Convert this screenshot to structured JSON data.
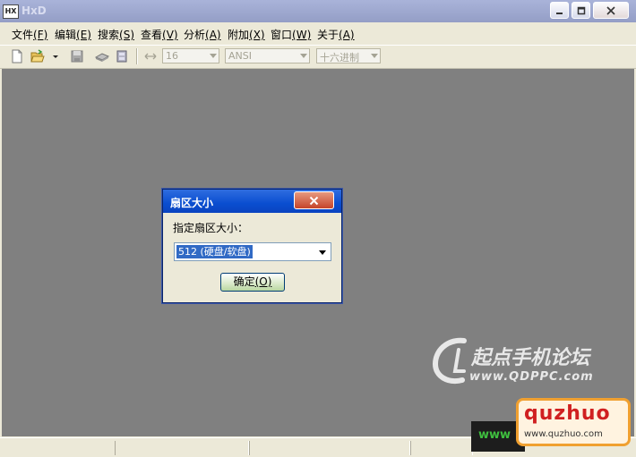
{
  "window": {
    "title": "HxD"
  },
  "caption_buttons": {
    "minimize": "minimize",
    "maximize": "maximize",
    "close": "close"
  },
  "menu": {
    "items": [
      {
        "label": "文件",
        "key": "(F)"
      },
      {
        "label": "编辑",
        "key": "(E)"
      },
      {
        "label": "搜索",
        "key": "(S)"
      },
      {
        "label": "查看",
        "key": "(V)"
      },
      {
        "label": "分析",
        "key": "(A)"
      },
      {
        "label": "附加",
        "key": "(X)"
      },
      {
        "label": "窗口",
        "key": "(W)"
      },
      {
        "label": "关于",
        "key": "(A)"
      }
    ]
  },
  "toolbar": {
    "bytes_per_row": "16",
    "charset": "ANSI",
    "offset_base": "十六进制"
  },
  "dialog": {
    "title": "扇区大小",
    "label": "指定扇区大小：",
    "selected_option": "512 (硬盘/软盘)",
    "ok_label": "确定",
    "ok_key": "(O)"
  },
  "watermarks": {
    "qdppc_name": "起点手机论坛",
    "qdppc_url": "www.QDPPC.com",
    "quzhuo_name": "quzhuo",
    "quzhuo_url": "www.quzhuo.com",
    "quzhuo_prefix": "www"
  },
  "colors": {
    "workspace": "#808080",
    "dialog_title": "#0a4ed0",
    "selection": "#316ac5"
  }
}
